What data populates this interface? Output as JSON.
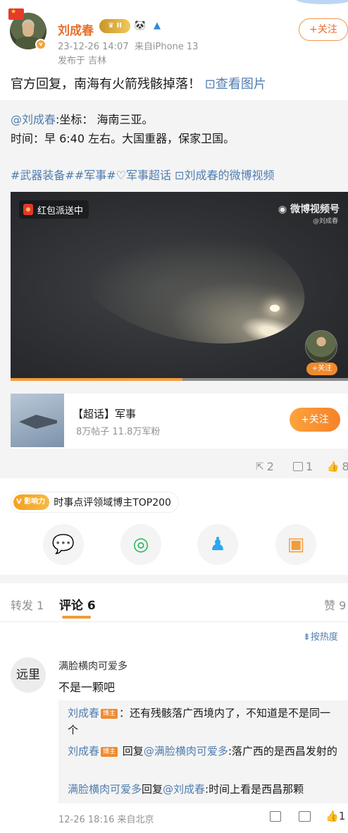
{
  "post": {
    "username": "刘成春",
    "level_badge": "II",
    "timestamp": "23-12-26 14:07",
    "device": "来自iPhone 13",
    "location": "发布于 吉林",
    "follow_label": "+关注",
    "title": "官方回复，南海有火箭残骸掉落！",
    "view_pics_label": "⊡查看图片"
  },
  "repost_block": {
    "mention": "@刘成春",
    "coord_text": ":坐标： 海南三亚。",
    "time_text": "时间：早 6:40 左右。大国重器，保家卫国。",
    "tags": "#武器装备##军事#♡军事超话 ⊡刘成春的微博视频"
  },
  "video": {
    "redpacket_label": "红包派送中",
    "watermark": "微博视频号",
    "watermark_sub": "@刘成春",
    "follow_label": "+关注",
    "progress": 0.51
  },
  "topic": {
    "title": "【超话】军事",
    "stats": "8万帖子 11.8万军粉",
    "follow_label": "+关注"
  },
  "actions": {
    "shares": "2",
    "comments": "1",
    "likes": "8"
  },
  "influence": {
    "tag": "V 影响力",
    "text": "时事点评领域博主TOP200"
  },
  "tabs": {
    "repost": "转发 1",
    "comments": "评论 6",
    "likes": "赞 9"
  },
  "sort_label": "⇟按热度",
  "comment": {
    "avatar_text": "远里",
    "username": "满脸横肉可爱多",
    "text": "不是一颗吧",
    "meta": "12-26 18:16  来自北京",
    "likes": "1",
    "replies": [
      {
        "name": "刘成春",
        "host": "博主",
        "text": "：还有残骸落广西境内了，不知道是不是同一个"
      },
      {
        "name": "刘成春",
        "host": "博主",
        "mid": " 回复",
        "target": "@满脸横肉可爱多",
        "text": ":落广西的是西昌发射的"
      },
      {
        "name": "满脸横肉可爱多",
        "mid": "回复",
        "target": "@刘成春",
        "text": ":时间上看是西昌那颗"
      }
    ]
  },
  "colors": {
    "accent": "#f29b3a",
    "link": "#507daf",
    "username": "#e86e2b"
  }
}
